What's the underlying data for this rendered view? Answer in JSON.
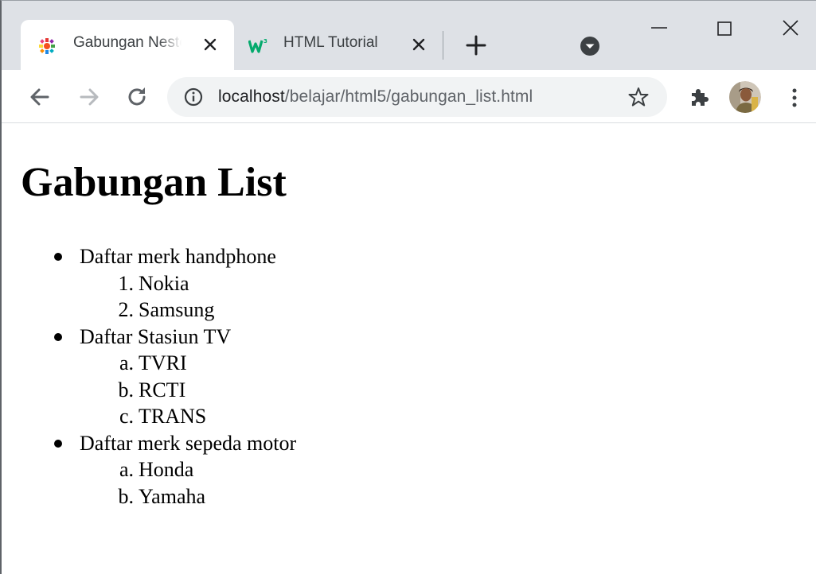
{
  "browser": {
    "tabs": [
      {
        "title": "Gabungan Nested List",
        "favicon": "puzzle-colorful-icon",
        "active": true
      },
      {
        "title": "HTML Tutorial",
        "favicon": "w3schools-icon",
        "active": false
      }
    ],
    "url_host": "localhost",
    "url_path": "/belajar/html5/gabungan_list.html",
    "icons": {
      "back": "back-arrow-icon",
      "forward": "forward-arrow-icon",
      "reload": "reload-icon",
      "info": "info-icon",
      "star": "star-icon",
      "extensions": "puzzle-icon",
      "menu": "three-dots-icon",
      "tab_search": "tab-search-icon",
      "new_tab": "plus-icon"
    },
    "colors": {
      "tabstrip": "#dee1e6",
      "omnibox": "#f1f3f4",
      "icon": "#5f6368"
    }
  },
  "page": {
    "heading": "Gabungan List",
    "groups": [
      {
        "label": "Daftar merk handphone",
        "markers": [
          "1.",
          "2."
        ],
        "items": [
          "Nokia",
          "Samsung"
        ]
      },
      {
        "label": "Daftar Stasiun TV",
        "markers": [
          "a.",
          "b.",
          "c."
        ],
        "items": [
          "TVRI",
          "RCTI",
          "TRANS"
        ]
      },
      {
        "label": "Daftar merk sepeda motor",
        "markers": [
          "a.",
          "b."
        ],
        "items": [
          "Honda",
          "Yamaha"
        ]
      }
    ]
  }
}
